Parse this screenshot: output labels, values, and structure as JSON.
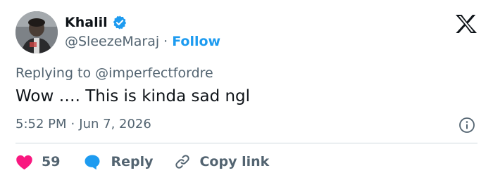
{
  "author": {
    "name": "Khalil",
    "handle": "@SleezeMaraj",
    "separator": "·",
    "follow_label": "Follow",
    "verified": true
  },
  "reply_context": {
    "prefix": "Replying to",
    "handle": "@imperfectfordre"
  },
  "tweet": {
    "text": "Wow …. This is kinda sad ngl",
    "time": "5:52 PM",
    "separator": "·",
    "date": "Jun 7, 2026"
  },
  "actions": {
    "like_count": "59",
    "reply_label": "Reply",
    "copy_link_label": "Copy link"
  },
  "icons": {
    "verified": "verified-badge-icon",
    "logo": "x-logo-icon",
    "info": "info-icon",
    "like": "heart-icon",
    "reply": "speech-bubble-icon",
    "copy": "link-icon"
  },
  "colors": {
    "accent": "#1d9bf0",
    "like": "#f91880",
    "text_primary": "#0f1419",
    "text_secondary": "#536471",
    "divider": "#cfd9de"
  }
}
